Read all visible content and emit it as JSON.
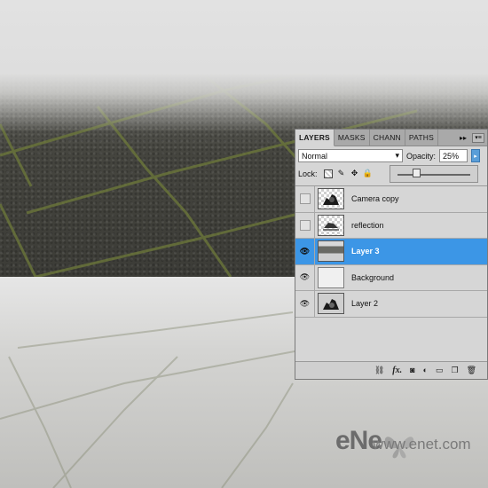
{
  "panel": {
    "tabs": [
      {
        "label": "LAYERS",
        "active": true
      },
      {
        "label": "MASKS",
        "active": false
      },
      {
        "label": "CHANN",
        "active": false
      },
      {
        "label": "PATHS",
        "active": false
      }
    ],
    "menu_glyphs": {
      "expand": "▸▸",
      "menu": "▾≡"
    },
    "blend_mode": "Normal",
    "opacity_label": "Opacity:",
    "opacity_value": "25%",
    "opacity_slider_level": 0.25,
    "lock_label": "Lock:",
    "layers": [
      {
        "name": "Camera copy",
        "visible": false,
        "selected": false,
        "thumb": "camera-checker"
      },
      {
        "name": "reflection",
        "visible": false,
        "selected": false,
        "thumb": "reflection-checker"
      },
      {
        "name": "Layer 3",
        "visible": true,
        "selected": true,
        "thumb": "pavement"
      },
      {
        "name": "Background",
        "visible": true,
        "selected": false,
        "thumb": "plain"
      },
      {
        "name": "Layer 2",
        "visible": true,
        "selected": false,
        "thumb": "camera-grey"
      }
    ],
    "bottom_icons": [
      "link-layers-icon",
      "fx-icon",
      "add-mask-icon",
      "adjustment-layer-icon",
      "new-group-icon",
      "new-layer-icon",
      "trash-icon"
    ],
    "fx_label": "fx."
  },
  "watermark": {
    "main": "eNe",
    "sub": "www.enet.com"
  },
  "colors": {
    "selection": "#3c96e6",
    "panel": "#d6d6d6",
    "tabbar": "#a9a9a9"
  }
}
